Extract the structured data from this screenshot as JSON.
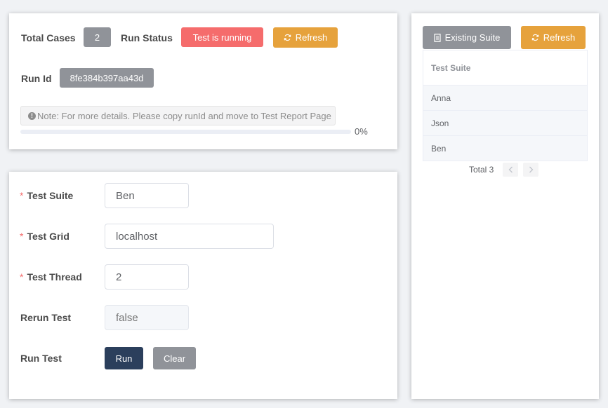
{
  "run_panel": {
    "total_cases_label": "Total Cases",
    "total_cases_value": "2",
    "run_status_label": "Run Status",
    "run_status_value": "Test is running",
    "refresh_label": "Refresh",
    "run_id_label": "Run Id",
    "run_id_value": "8fe384b397aa43d",
    "note_icon": "info-icon",
    "note_text": "Note: For more details. Please copy runId and move to Test Report Page",
    "progress_percent": 0,
    "progress_text": "0%"
  },
  "form": {
    "test_suite_label": "Test Suite",
    "test_suite_value": "Ben",
    "test_grid_label": "Test Grid",
    "test_grid_value": "localhost",
    "test_thread_label": "Test Thread",
    "test_thread_value": "2",
    "rerun_test_label": "Rerun Test",
    "rerun_test_placeholder": "false",
    "run_test_label": "Run Test",
    "run_button_label": "Run",
    "clear_button_label": "Clear",
    "required_mark": "*"
  },
  "suites_panel": {
    "existing_suite_label": "Existing Suite",
    "refresh_label": "Refresh",
    "table_header": "Test Suite",
    "rows": [
      "Anna",
      "Json",
      "Ben"
    ],
    "pagination_total": "Total 3",
    "prev_icon": "chevron-left-icon",
    "next_icon": "chevron-right-icon"
  },
  "colors": {
    "count_tag": "#909399",
    "status_running": "#f56c6c",
    "refresh": "#e6a23c",
    "run_button": "#2b3f5c",
    "clear_button": "#909399"
  }
}
